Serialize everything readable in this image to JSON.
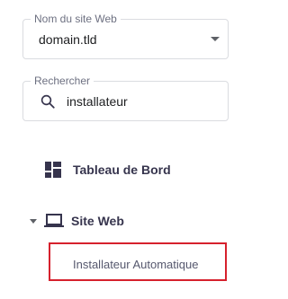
{
  "site_select": {
    "label": "Nom du site Web",
    "value": "domain.tld"
  },
  "search": {
    "label": "Rechercher",
    "value": "installateur"
  },
  "nav": {
    "dashboard": {
      "label": "Tableau de Bord",
      "icon": "dashboard-icon"
    },
    "website": {
      "label": "Site Web",
      "icon": "laptop-icon",
      "expanded": true,
      "children": [
        {
          "label": "Installateur Automatique",
          "highlighted": true
        }
      ]
    }
  },
  "colors": {
    "highlight_border": "#d6212d",
    "field_border": "#dadce0"
  }
}
